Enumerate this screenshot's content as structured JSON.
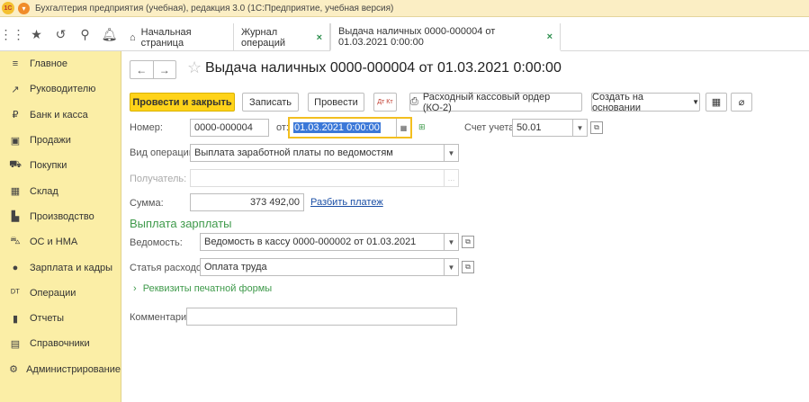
{
  "titlebar": {
    "logo": "1С",
    "title": "Бухгалтерия предприятия (учебная), редакция 3.0  (1С:Предприятие, учебная версия)"
  },
  "toolbar_icons": [
    "apps-grid-icon",
    "star-icon",
    "history-icon",
    "search-icon",
    "bell-icon"
  ],
  "tabs": [
    {
      "label": "Начальная страница",
      "icon": "home-icon"
    },
    {
      "label": "Журнал операций",
      "close": "×"
    },
    {
      "label": "Выдача наличных 0000-000004 от 01.03.2021 0:00:00",
      "close": "×",
      "active": true
    }
  ],
  "sidebar": {
    "items": [
      {
        "label": "Главное",
        "icon": "menu-icon",
        "glyph": "≡"
      },
      {
        "label": "Руководителю",
        "icon": "trend-icon",
        "glyph": "↗"
      },
      {
        "label": "Банк и касса",
        "icon": "coin-icon",
        "glyph": "₽"
      },
      {
        "label": "Продажи",
        "icon": "bag-icon",
        "glyph": "▣"
      },
      {
        "label": "Покупки",
        "icon": "cart-icon",
        "glyph": "⛟"
      },
      {
        "label": "Склад",
        "icon": "warehouse-icon",
        "glyph": "▦"
      },
      {
        "label": "Производство",
        "icon": "factory-icon",
        "glyph": "▙"
      },
      {
        "label": "ОС и НМА",
        "icon": "truck-icon",
        "glyph": "⛍"
      },
      {
        "label": "Зарплата и кадры",
        "icon": "person-icon",
        "glyph": "●"
      },
      {
        "label": "Операции",
        "icon": "dt-kt-icon",
        "glyph": "ᴰᵀ"
      },
      {
        "label": "Отчеты",
        "icon": "bar-chart-icon",
        "glyph": "▮"
      },
      {
        "label": "Справочники",
        "icon": "book-icon",
        "glyph": "▤"
      },
      {
        "label": "Администрирование",
        "icon": "gear-icon",
        "glyph": "⚙"
      }
    ]
  },
  "form": {
    "title": "Выдача наличных 0000-000004 от 01.03.2021 0:00:00",
    "buttons": {
      "post_close": "Провести и закрыть",
      "save": "Записать",
      "post": "Провести",
      "dt_kt": "Дт Кт",
      "print": "Расходный кассовый ордер (КО-2)",
      "create_based": "Создать на основании"
    },
    "number_label": "Номер:",
    "number_value": "0000-000004",
    "date_label": "от:",
    "date_value": "01.03.2021  0:00:00",
    "account_label": "Счет учета:",
    "account_value": "50.01",
    "operation_label": "Вид операции:",
    "operation_value": "Выплата заработной платы по ведомостям",
    "recipient_label": "Получатель:",
    "recipient_value": "",
    "sum_label": "Сумма:",
    "sum_value": "373 492,00",
    "split_link": "Разбить платеж",
    "section_title": "Выплата зарплаты",
    "statement_label": "Ведомость:",
    "statement_value": "Ведомость в кассу 0000-000002 от 01.03.2021",
    "expense_label": "Статья расходов:",
    "expense_value": "Оплата труда",
    "print_details": "Реквизиты печатной формы",
    "comment_label": "Комментарий:",
    "comment_value": ""
  },
  "colors": {
    "sidebar": "#fbeea6",
    "primary_button": "#ffd319",
    "section_green": "#3f9a4b",
    "link_blue": "#1a4ea5",
    "selection": "#3b78d8"
  }
}
